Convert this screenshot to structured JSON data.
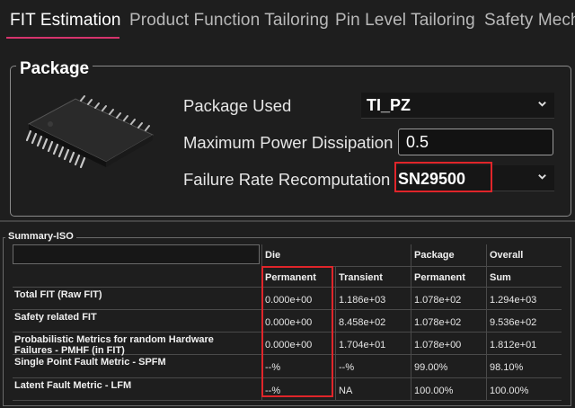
{
  "tabs": [
    {
      "label": "FIT Estimation",
      "active": true
    },
    {
      "label": "Product Function Tailoring",
      "active": false
    },
    {
      "label": "Pin Level Tailoring",
      "active": false
    },
    {
      "label": "Safety Mech",
      "active": false
    }
  ],
  "package": {
    "title": "Package",
    "package_used_label": "Package Used",
    "package_used_value": "TI_PZ",
    "max_power_label": "Maximum Power Dissipation",
    "max_power_value": "0.5",
    "failure_rate_label": "Failure Rate Recomputation",
    "failure_rate_value": "SN29500"
  },
  "summary": {
    "title": "Summary-ISO",
    "group_headers": {
      "die": "Die",
      "package": "Package",
      "overall": "Overall"
    },
    "columns": [
      "Permanent",
      "Transient",
      "Permanent",
      "Sum"
    ],
    "rows": [
      {
        "label": "Total FIT (Raw FIT)",
        "values": [
          "0.000e+00",
          "1.186e+03",
          "1.078e+02",
          "1.294e+03"
        ]
      },
      {
        "label": "Safety related FIT",
        "values": [
          "0.000e+00",
          "8.458e+02",
          "1.078e+02",
          "9.536e+02"
        ]
      },
      {
        "label": "Probabilistic Metrics for random Hardware Failures - PMHF (in FIT)",
        "label_line1": "Probabilistic Metrics for random Hardware",
        "label_line2": "Failures - PMHF (in FIT)",
        "values": [
          "0.000e+00",
          "1.704e+01",
          "1.078e+00",
          "1.812e+01"
        ]
      },
      {
        "label": "Single Point Fault Metric - SPFM",
        "values": [
          "--%",
          "--%",
          "99.00%",
          "98.10%"
        ]
      },
      {
        "label": "Latent Fault Metric - LFM",
        "values": [
          "--%",
          "NA",
          "100.00%",
          "100.00%"
        ]
      }
    ]
  },
  "colors": {
    "accent": "#d6336c",
    "highlight": "#e0252a",
    "background": "#1e1e1e"
  }
}
